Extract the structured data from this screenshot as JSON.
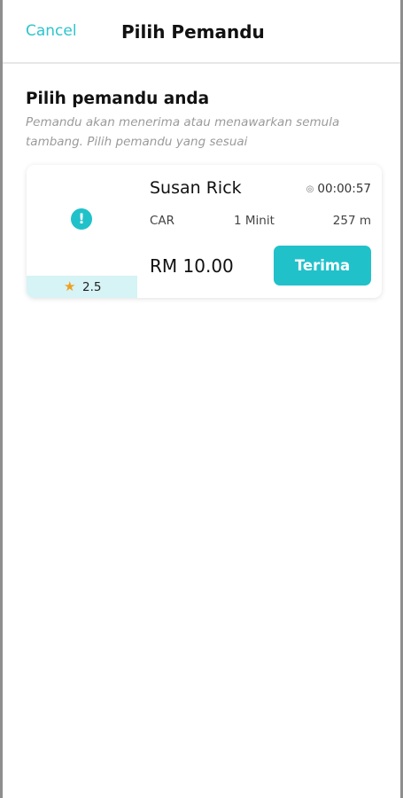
{
  "header": {
    "cancel_label": "Cancel",
    "title": "Pilih Pemandu"
  },
  "section": {
    "title": "Pilih pemandu anda",
    "description": "Pemandu akan menerima atau menawarkan semula tambang. Pilih pemandu yang sesuai"
  },
  "driver": {
    "alert_icon_glyph": "!",
    "rating_icon": "★",
    "rating": "2.5",
    "name": "Susan Rick",
    "timer_icon": "◎",
    "timer": "00:00:57",
    "vehicle_type": "CAR",
    "eta": "1 Minit",
    "distance": "257 m",
    "price": "RM 10.00",
    "accept_label": "Terima"
  },
  "colors": {
    "accent": "#21c1ca",
    "rating_bar_bg": "#d6f3f5",
    "star": "#f0a020"
  }
}
